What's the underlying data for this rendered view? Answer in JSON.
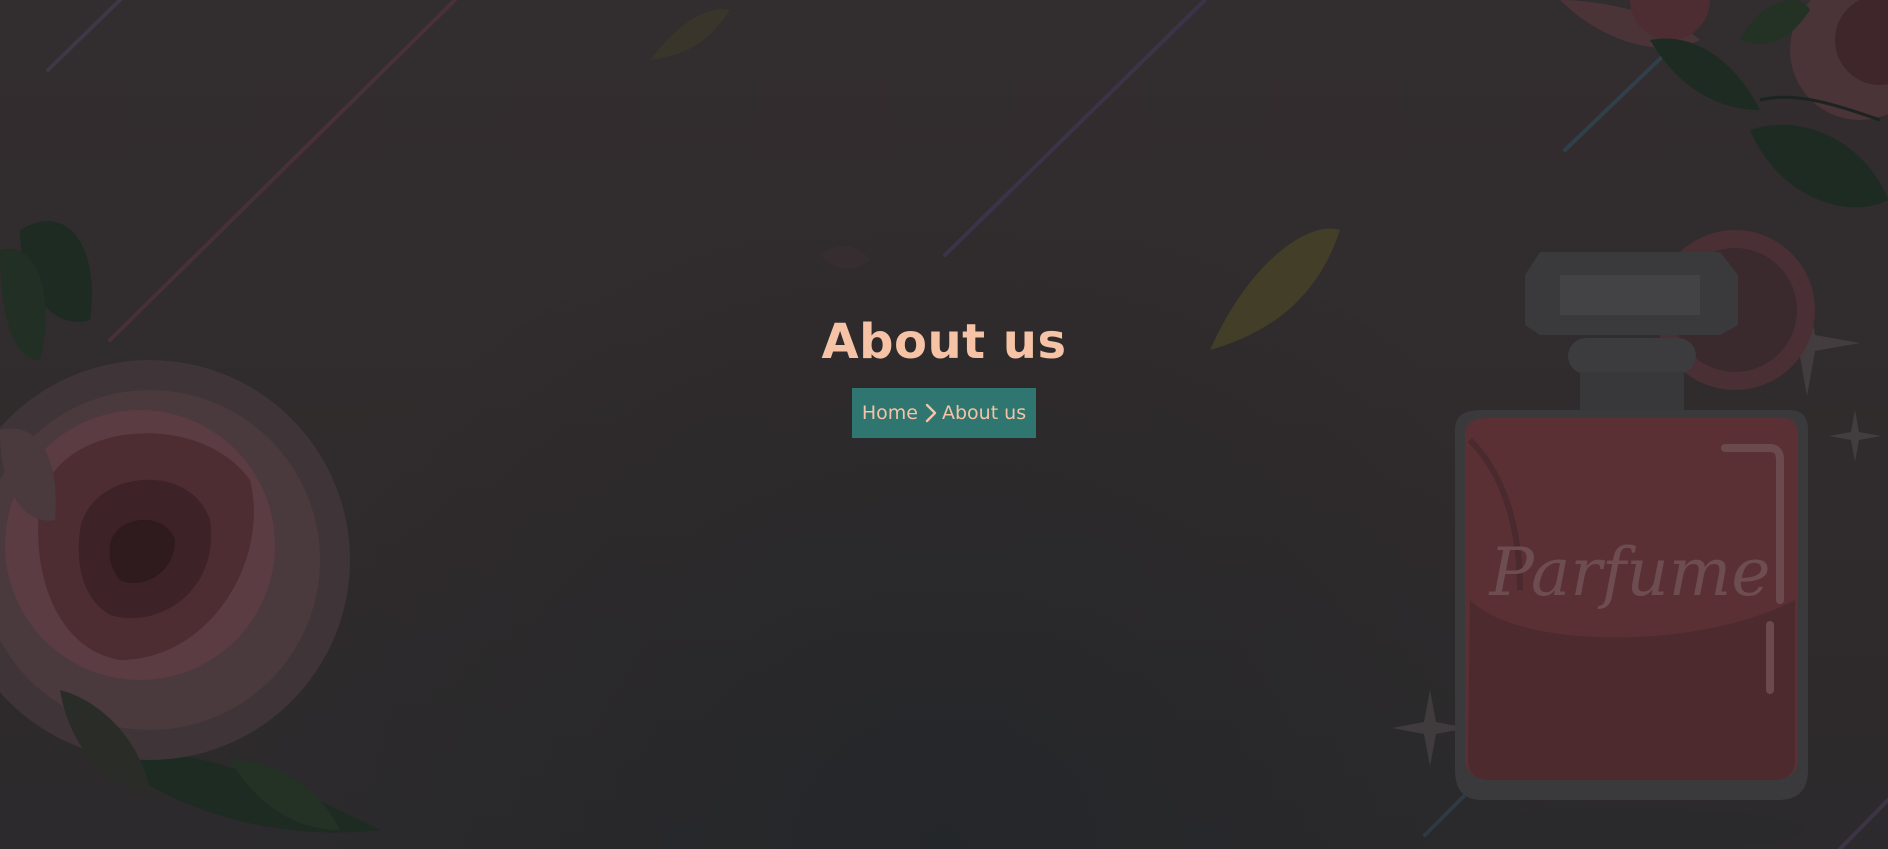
{
  "hero": {
    "title": "About us",
    "bottle_label": "Parfume"
  },
  "breadcrumb": {
    "home_label": "Home",
    "current_label": "About us",
    "separator_icon": "chevron-right-icon"
  },
  "colors": {
    "title": "#f6c3a6",
    "breadcrumb_bg": "#2f7670",
    "overlay": "#2f2b2c"
  }
}
